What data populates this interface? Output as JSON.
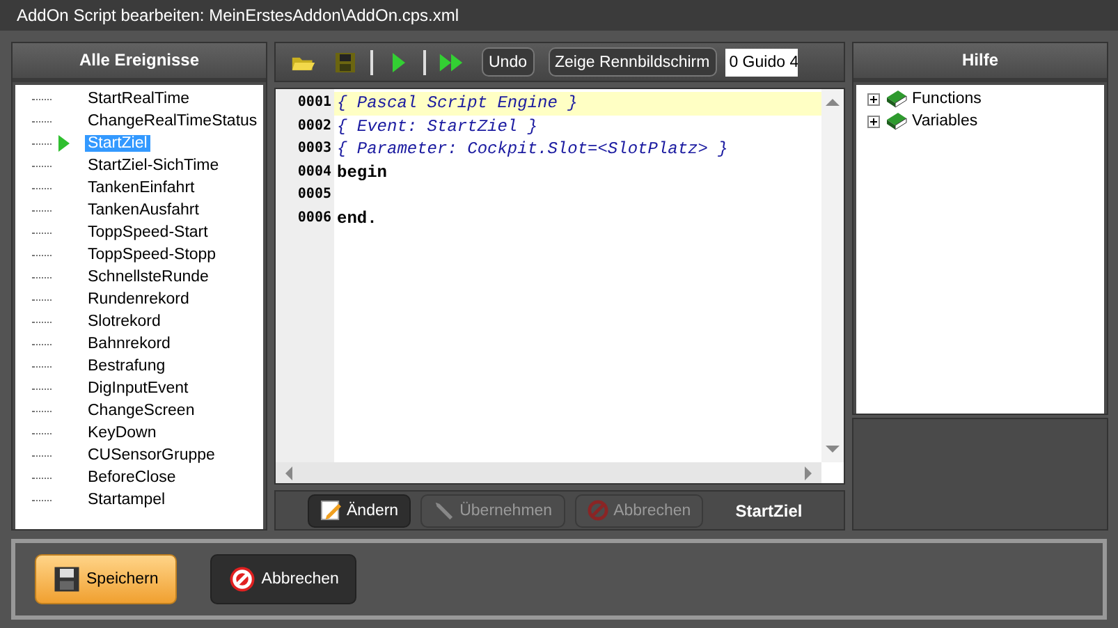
{
  "window": {
    "title": "AddOn Script bearbeiten: MeinErstesAddon\\AddOn.cps.xml"
  },
  "events": {
    "title": "Alle Ereignisse",
    "items": [
      {
        "label": "StartRealTime",
        "selected": false
      },
      {
        "label": "ChangeRealTimeStatus",
        "selected": false
      },
      {
        "label": "StartZiel",
        "selected": true
      },
      {
        "label": "StartZiel-SichTime",
        "selected": false
      },
      {
        "label": "TankenEinfahrt",
        "selected": false
      },
      {
        "label": "TankenAusfahrt",
        "selected": false
      },
      {
        "label": "ToppSpeed-Start",
        "selected": false
      },
      {
        "label": "ToppSpeed-Stopp",
        "selected": false
      },
      {
        "label": "SchnellsteRunde",
        "selected": false
      },
      {
        "label": "Rundenrekord",
        "selected": false
      },
      {
        "label": "Slotrekord",
        "selected": false
      },
      {
        "label": "Bahnrekord",
        "selected": false
      },
      {
        "label": "Bestrafung",
        "selected": false
      },
      {
        "label": "DigInputEvent",
        "selected": false
      },
      {
        "label": "ChangeScreen",
        "selected": false
      },
      {
        "label": "KeyDown",
        "selected": false
      },
      {
        "label": "CUSensorGruppe",
        "selected": false
      },
      {
        "label": "BeforeClose",
        "selected": false
      },
      {
        "label": "Startampel",
        "selected": false
      }
    ]
  },
  "toolbar": {
    "buttons": [
      "Undo",
      "Zeige Rennbildschirm"
    ],
    "combo": "0 Guido 4"
  },
  "editor": {
    "lines": [
      {
        "number": "0001",
        "text": "{ Pascal Script Engine }",
        "kind": "comment",
        "highlighted": true
      },
      {
        "number": "0002",
        "text": "{ Event: StartZiel }",
        "kind": "comment",
        "highlighted": false
      },
      {
        "number": "0003",
        "text": "{ Parameter: Cockpit.Slot=<SlotPlatz> }",
        "kind": "comment",
        "highlighted": false
      },
      {
        "number": "0004",
        "text": "begin",
        "kind": "keyword",
        "highlighted": false
      },
      {
        "number": "0005",
        "kind": "blank",
        "highlighted": false
      },
      {
        "number": "0006",
        "text": "end.",
        "kind": "keyword",
        "highlighted": false
      }
    ]
  },
  "editor_actions": {
    "buttons": [
      {
        "label": "Ändern",
        "kind": "edit",
        "disabled": false
      },
      {
        "label": "Übernehmen",
        "kind": "apply",
        "disabled": true
      },
      {
        "label": "Abbrechen",
        "kind": "cancel",
        "disabled": true
      }
    ],
    "current_event": "StartZiel"
  },
  "help": {
    "title": "Hilfe",
    "items": [
      {
        "label": "Functions",
        "expanded": false
      },
      {
        "label": "Variables",
        "expanded": false
      }
    ]
  },
  "footer": {
    "buttons": [
      {
        "label": "Speichern",
        "kind": "save",
        "primary": true
      },
      {
        "label": "Abbrechen",
        "kind": "cancel",
        "primary": false
      }
    ]
  }
}
